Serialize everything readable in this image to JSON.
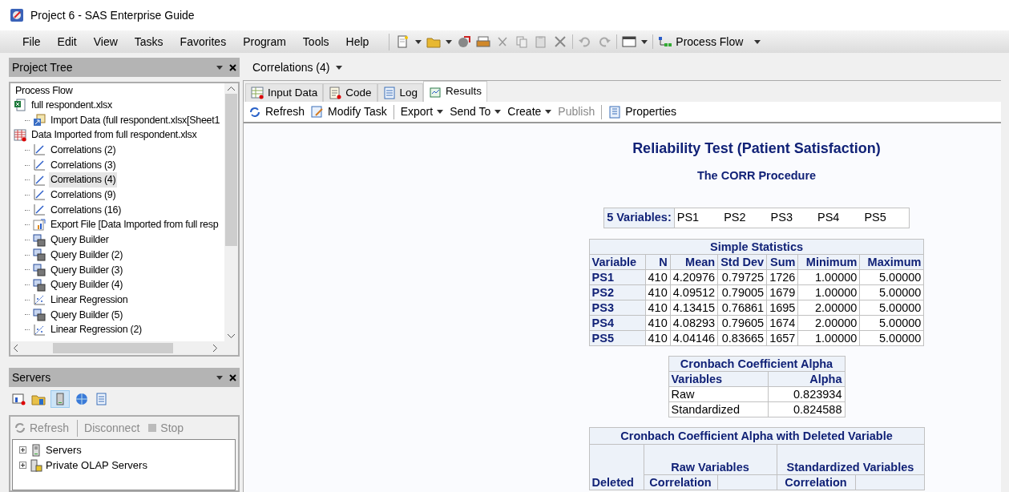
{
  "window": {
    "title": "Project 6 - SAS Enterprise Guide"
  },
  "menu": [
    "File",
    "Edit",
    "View",
    "Tasks",
    "Favorites",
    "Program",
    "Tools",
    "Help"
  ],
  "toolbar": {
    "process_flow": "Process Flow"
  },
  "project_tree": {
    "title": "Project Tree",
    "root": "Process Flow",
    "items": [
      {
        "label": "full respondent.xlsx",
        "kind": "excel",
        "selected": false,
        "children": [
          {
            "label": "Import Data (full respondent.xlsx[Sheet1",
            "kind": "import",
            "selected": false
          }
        ]
      },
      {
        "label": "Data Imported from full respondent.xlsx",
        "kind": "dataset",
        "selected": false,
        "children": [
          {
            "label": "Correlations (2)",
            "kind": "correlation",
            "selected": false
          },
          {
            "label": "Correlations (3)",
            "kind": "correlation",
            "selected": false
          },
          {
            "label": "Correlations (4)",
            "kind": "correlation",
            "selected": true
          },
          {
            "label": "Correlations (9)",
            "kind": "correlation",
            "selected": false
          },
          {
            "label": "Correlations (16)",
            "kind": "correlation",
            "selected": false
          },
          {
            "label": "Export File [Data Imported from full resp",
            "kind": "export",
            "selected": false
          },
          {
            "label": "Query Builder",
            "kind": "query",
            "selected": false
          },
          {
            "label": "Query Builder (2)",
            "kind": "query",
            "selected": false
          },
          {
            "label": "Query Builder (3)",
            "kind": "query",
            "selected": false
          },
          {
            "label": "Query Builder (4)",
            "kind": "query",
            "selected": false
          },
          {
            "label": "Linear Regression",
            "kind": "regression",
            "selected": false
          },
          {
            "label": "Query Builder (5)",
            "kind": "query",
            "selected": false
          },
          {
            "label": "Linear Regression (2)",
            "kind": "regression",
            "selected": false
          }
        ]
      }
    ]
  },
  "servers": {
    "title": "Servers",
    "toolbar": [
      {
        "label": "Refresh",
        "kind": "refresh",
        "disabled": true
      },
      {
        "label": "Disconnect",
        "kind": "plain",
        "disabled": true
      },
      {
        "label": "Stop",
        "kind": "stop",
        "disabled": true
      }
    ],
    "items": [
      {
        "label": "Servers",
        "kind": "server",
        "expanded": false
      },
      {
        "label": "Private OLAP Servers",
        "kind": "olap",
        "expanded": false
      }
    ]
  },
  "document": {
    "title": "Correlations (4)"
  },
  "tabs": [
    {
      "label": "Input Data",
      "kind": "data",
      "selected": false
    },
    {
      "label": "Code",
      "kind": "code",
      "selected": false
    },
    {
      "label": "Log",
      "kind": "log",
      "selected": false
    },
    {
      "label": "Results",
      "kind": "results",
      "selected": true
    }
  ],
  "results_toolbar": [
    {
      "label": "Refresh",
      "kind": "refresh",
      "dropdown": false,
      "disabled": false
    },
    {
      "label": "Modify Task",
      "kind": "modify",
      "dropdown": false,
      "disabled": false
    },
    {
      "label": "Export",
      "kind": "plain",
      "dropdown": true,
      "disabled": false
    },
    {
      "label": "Send To",
      "kind": "plain",
      "dropdown": true,
      "disabled": false
    },
    {
      "label": "Create",
      "kind": "plain",
      "dropdown": true,
      "disabled": false
    },
    {
      "label": "Publish",
      "kind": "plain",
      "dropdown": false,
      "disabled": true
    },
    {
      "label": "Properties",
      "kind": "properties",
      "dropdown": false,
      "disabled": false
    }
  ],
  "report": {
    "title": "Reliability Test (Patient Satisfaction)",
    "subtitle": "The CORR Procedure",
    "variables": {
      "label": "5  Variables:",
      "names": [
        "PS1",
        "PS2",
        "PS3",
        "PS4",
        "PS5"
      ]
    },
    "simple_statistics": {
      "title": "Simple Statistics",
      "columns": [
        "Variable",
        "N",
        "Mean",
        "Std Dev",
        "Sum",
        "Minimum",
        "Maximum"
      ],
      "rows": [
        [
          "PS1",
          "410",
          "4.20976",
          "0.79725",
          "1726",
          "1.00000",
          "5.00000"
        ],
        [
          "PS2",
          "410",
          "4.09512",
          "0.79005",
          "1679",
          "1.00000",
          "5.00000"
        ],
        [
          "PS3",
          "410",
          "4.13415",
          "0.76861",
          "1695",
          "2.00000",
          "5.00000"
        ],
        [
          "PS4",
          "410",
          "4.08293",
          "0.79605",
          "1674",
          "2.00000",
          "5.00000"
        ],
        [
          "PS5",
          "410",
          "4.04146",
          "0.83665",
          "1657",
          "1.00000",
          "5.00000"
        ]
      ]
    },
    "alpha": {
      "title": "Cronbach Coefficient Alpha",
      "columns": [
        "Variables",
        "Alpha"
      ],
      "rows": [
        [
          "Raw",
          "0.823934"
        ],
        [
          "Standardized",
          "0.824588"
        ]
      ]
    },
    "deleted": {
      "title": "Cronbach Coefficient Alpha with Deleted Variable",
      "row_header": "Deleted",
      "groups": [
        "Raw Variables",
        "Standardized Variables"
      ],
      "subcolumns": [
        "Correlation",
        "Correlation"
      ]
    }
  }
}
